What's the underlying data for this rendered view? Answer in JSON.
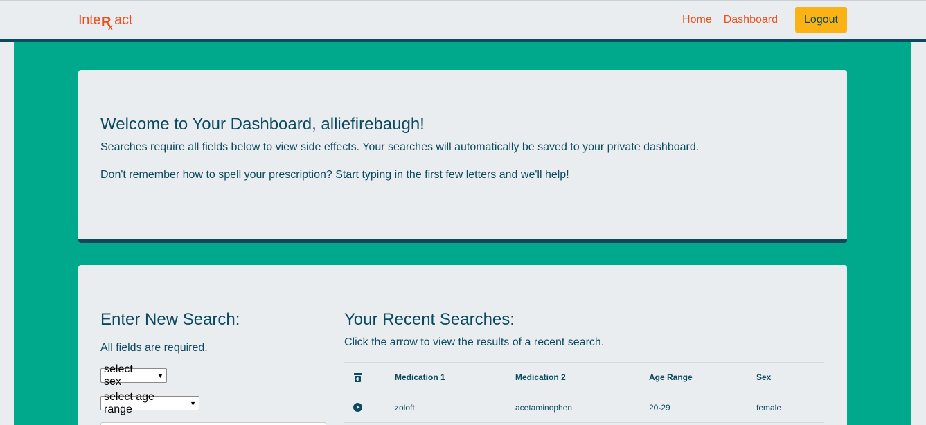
{
  "nav": {
    "brand_prefix": "Inte",
    "brand_suffix": "act",
    "links": [
      "Home",
      "Dashboard"
    ],
    "logout_label": "Logout"
  },
  "welcome": {
    "title": "Welcome to Your Dashboard, alliefirebaugh!",
    "p1": "Searches require all fields below to view side effects. Your searches will automatically be saved to your private dashboard.",
    "p2": "Don't remember how to spell your prescription? Start typing in the first few letters and we'll help!"
  },
  "search": {
    "title": "Enter New Search:",
    "subtitle": "All fields are required.",
    "sex_select": "select sex",
    "age_select": "select age range"
  },
  "recent": {
    "title": "Your Recent Searches:",
    "subtitle": "Click the arrow to view the results of a recent search.",
    "columns": [
      "Medication 1",
      "Medication 2",
      "Age Range",
      "Sex"
    ],
    "rows": [
      {
        "med1": "zoloft",
        "med2": "acetaminophen",
        "age": "20-29",
        "sex": "female"
      }
    ]
  },
  "colors": {
    "accent": "#ea4f1b",
    "primary": "#0b4a5e",
    "background": "#00a98c",
    "button": "#fbb214"
  },
  "icons": {
    "brand_rx": "rx-icon",
    "header_col": "pill-bottle-icon",
    "row_action": "play-circle-icon"
  }
}
